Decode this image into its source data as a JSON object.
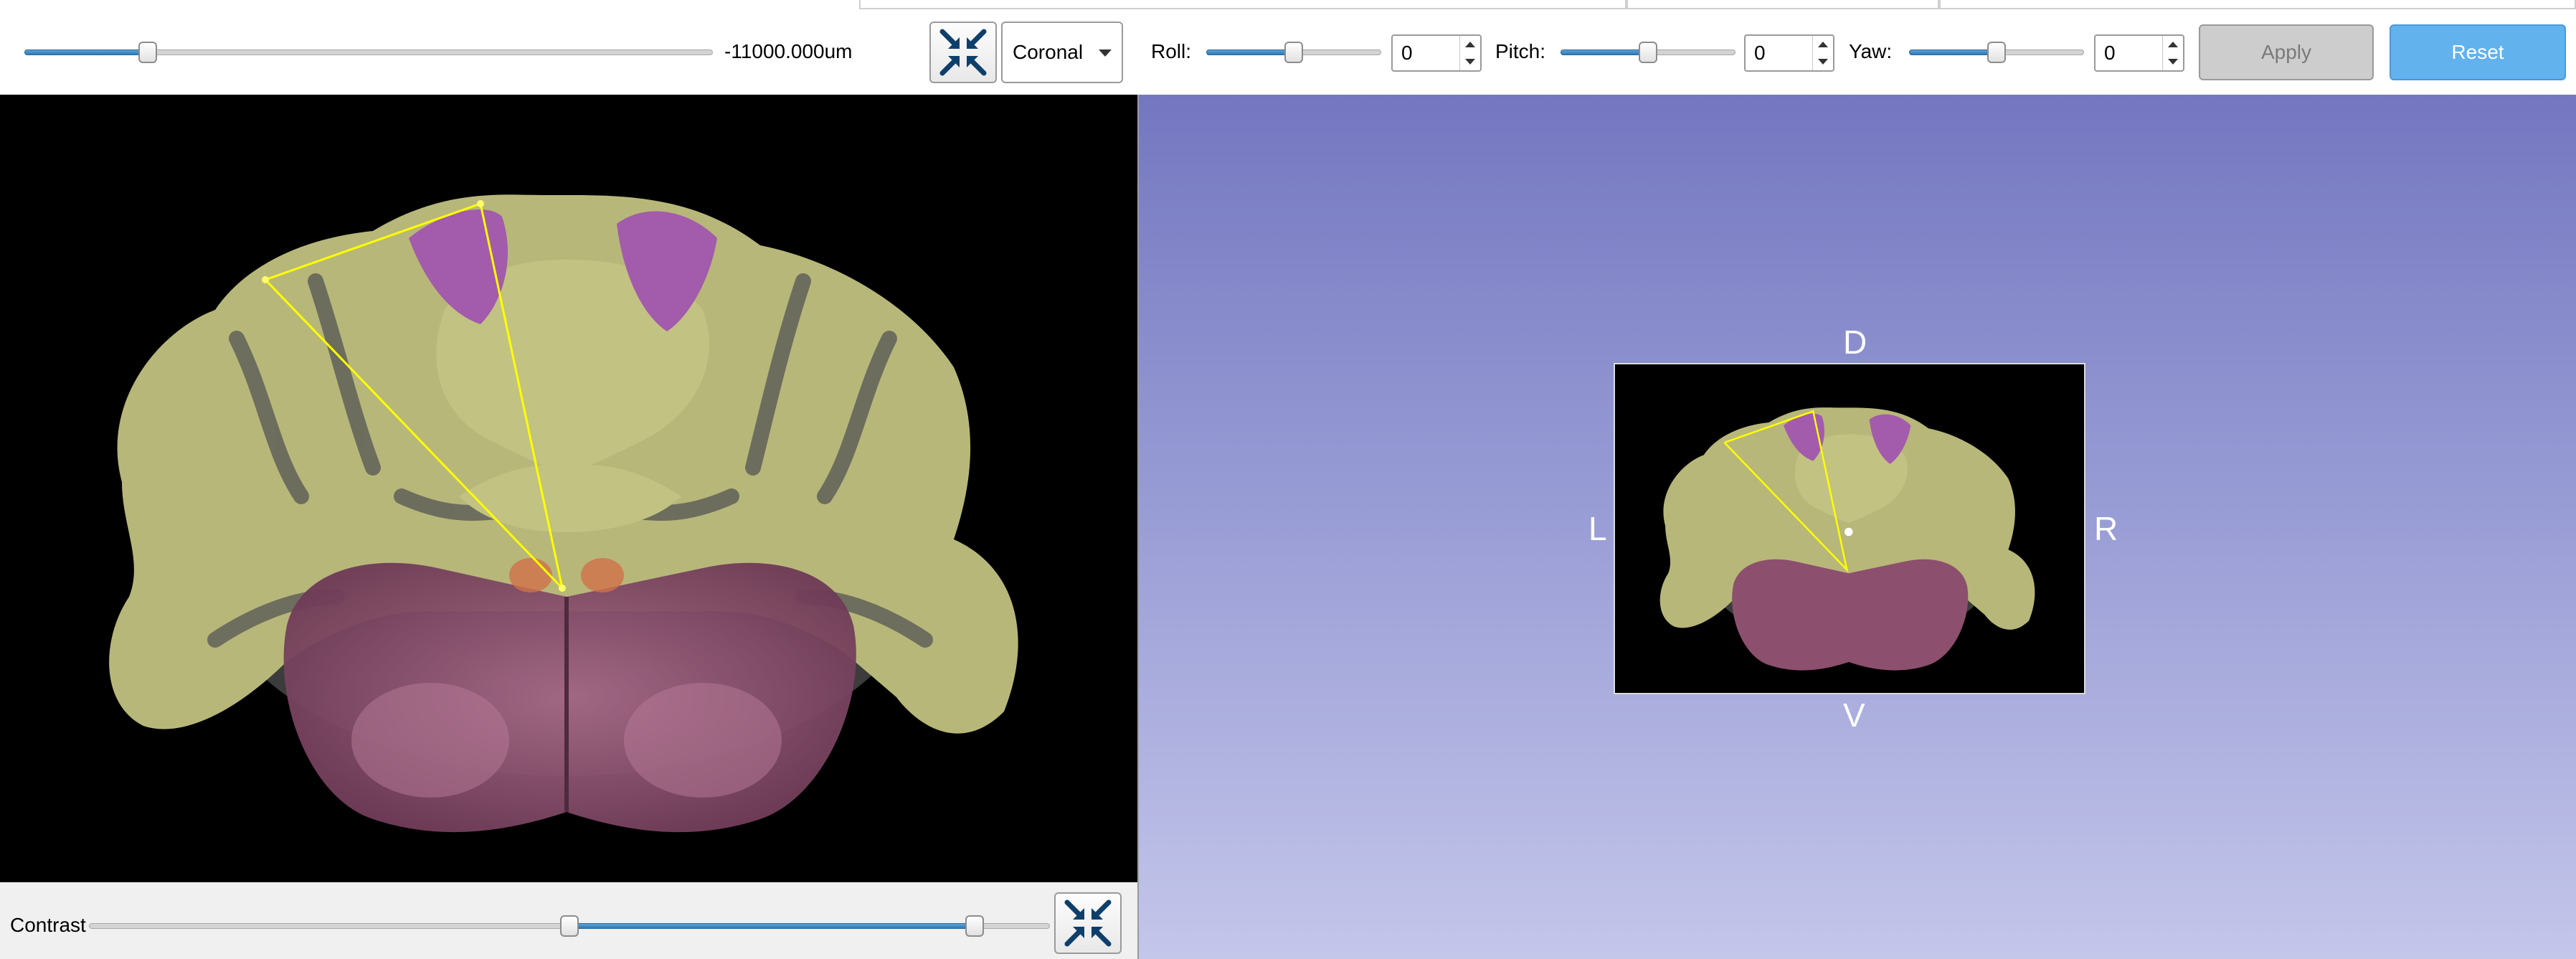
{
  "toolbar": {
    "position_readout": "-11000.000um",
    "plane": {
      "selected": "Coronal"
    },
    "roll": {
      "label": "Roll:",
      "value": "0"
    },
    "pitch": {
      "label": "Pitch:",
      "value": "0"
    },
    "yaw": {
      "label": "Yaw:",
      "value": "0"
    },
    "apply_label": "Apply",
    "reset_label": "Reset",
    "apply_enabled": false
  },
  "sliders": {
    "position_fraction": 0.17,
    "roll_fraction": 0.5,
    "pitch_fraction": 0.5,
    "yaw_fraction": 0.5
  },
  "view3d": {
    "labels": {
      "dorsal": "D",
      "ventral": "V",
      "left": "L",
      "right": "R"
    }
  },
  "bottom": {
    "contrast_label": "Contrast",
    "contrast_range": [
      0.5,
      0.93
    ]
  },
  "icons": {
    "shrink": "collapse-arrows-icon",
    "dropdown": "chevron-down-icon"
  },
  "colors": {
    "accent": "#2c79b8",
    "reset_button": "#62b2ee",
    "apply_disabled": "#cdcdcd",
    "cerebellum": "#b7b77a",
    "cortex_magenta": "#a35bab",
    "brainstem": "#8d4f6e",
    "annotation_line": "#ffff00",
    "view3d_top": "#7477c0",
    "view3d_bottom": "#c4c6ea"
  }
}
